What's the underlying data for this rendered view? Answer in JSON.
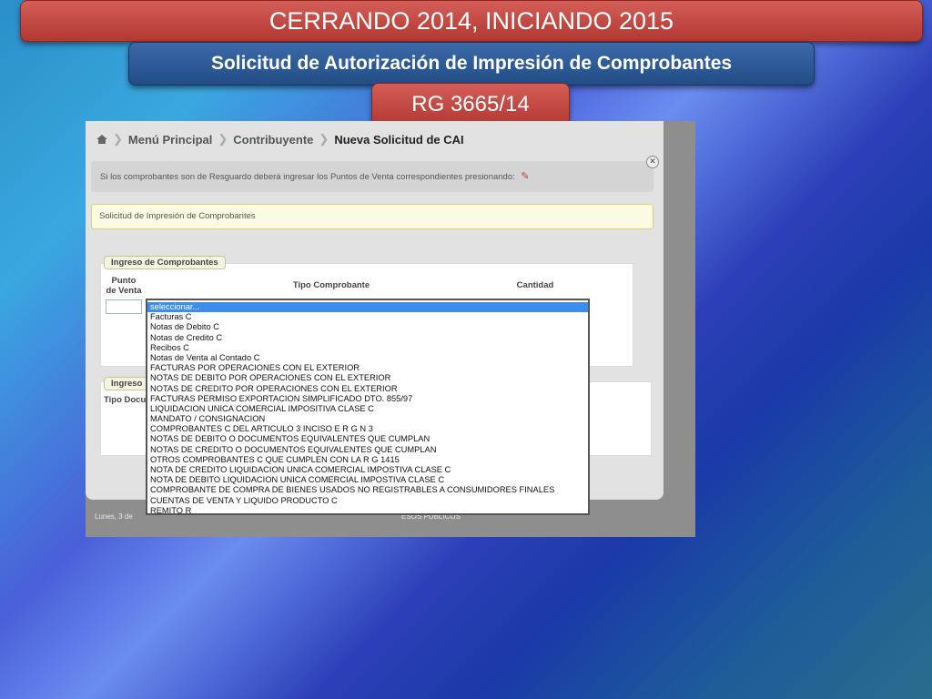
{
  "slide": {
    "title": "CERRANDO 2014, INICIANDO 2015",
    "subtitle": "Solicitud de Autorización de Impresión de Comprobantes",
    "tag": "RG 3665/14"
  },
  "app": {
    "breadcrumb": [
      "Menú Principal",
      "Contribuyente",
      "Nueva Solicitud de CAI"
    ],
    "notice": "Si los comprobantes son de Resguardo deberá ingresar los Puntos de Venta correspondientes presionando:",
    "section_title": "Solicitud de Impresión de Comprobantes",
    "fieldset1_legend": "Ingreso de Comprobantes",
    "columns": {
      "punto_line1": "Punto",
      "punto_line2": "de Venta",
      "tipo": "Tipo Comprobante",
      "cantidad": "Cantidad"
    },
    "fieldset2_legend": "Ingreso",
    "fieldset2_label": "Tipo Docu",
    "footer_left": "Lunes, 3 de",
    "footer_right": "ESOS PUBLICOS",
    "dropdown_options": [
      "seleccionar...",
      "Facturas C",
      "Notas de Debito C",
      "Notas de Credito C",
      "Recibos C",
      "Notas de Venta al Contado C",
      "FACTURAS POR OPERACIONES CON EL EXTERIOR",
      "NOTAS DE DEBITO POR OPERACIONES CON EL EXTERIOR",
      "NOTAS DE CREDITO POR OPERACIONES CON EL EXTERIOR",
      "FACTURAS PERMISO EXPORTACION SIMPLIFICADO DTO. 855/97",
      "LIQUIDACION UNICA COMERCIAL IMPOSITIVA CLASE C",
      "MANDATO / CONSIGNACION",
      "COMPROBANTES C DEL ARTICULO 3 INCISO E R G N 3",
      "NOTAS DE DEBITO O DOCUMENTOS EQUIVALENTES QUE CUMPLAN",
      "NOTAS DE CREDITO O DOCUMENTOS EQUIVALENTES QUE CUMPLAN",
      "OTROS COMPROBANTES C QUE CUMPLEN CON LA R G 1415",
      "NOTA DE CREDITO LIQUIDACION UNICA COMERCIAL IMPOSTIVA CLASE C",
      "NOTA DE DEBITO LIQUIDACION UNICA COMERCIAL IMPOSTIVA CLASE C",
      "COMPROBANTE DE COMPRA DE BIENES USADOS NO REGISTRABLES A CONSUMIDORES FINALES",
      "CUENTAS DE VENTA Y LIQUIDO PRODUCTO C",
      "REMITO R"
    ]
  }
}
